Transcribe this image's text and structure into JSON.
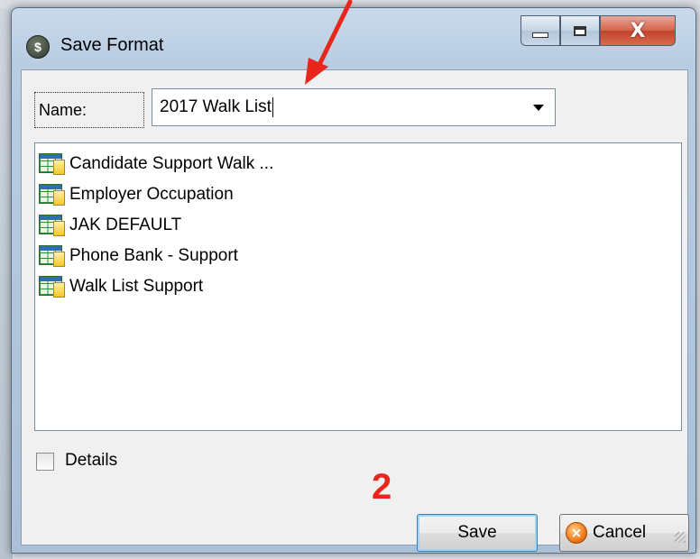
{
  "window": {
    "title": "Save Format",
    "close_glyph": "X"
  },
  "name_field": {
    "label": "Name:",
    "value": "2017 Walk List"
  },
  "formats": [
    {
      "label": "Candidate Support Walk ...",
      "icon": "grid-table-icon"
    },
    {
      "label": "Employer Occupation",
      "icon": "grid-table-icon"
    },
    {
      "label": "JAK DEFAULT",
      "icon": "grid-table-icon"
    },
    {
      "label": "Phone Bank - Support",
      "icon": "grid-table-icon"
    },
    {
      "label": "Walk List Support",
      "icon": "grid-table-icon"
    }
  ],
  "details": {
    "label": "Details",
    "checked": false
  },
  "buttons": {
    "save_label": "Save",
    "cancel_label": "Cancel"
  },
  "annotation": {
    "step_number": "2",
    "color": "#e8261c"
  }
}
